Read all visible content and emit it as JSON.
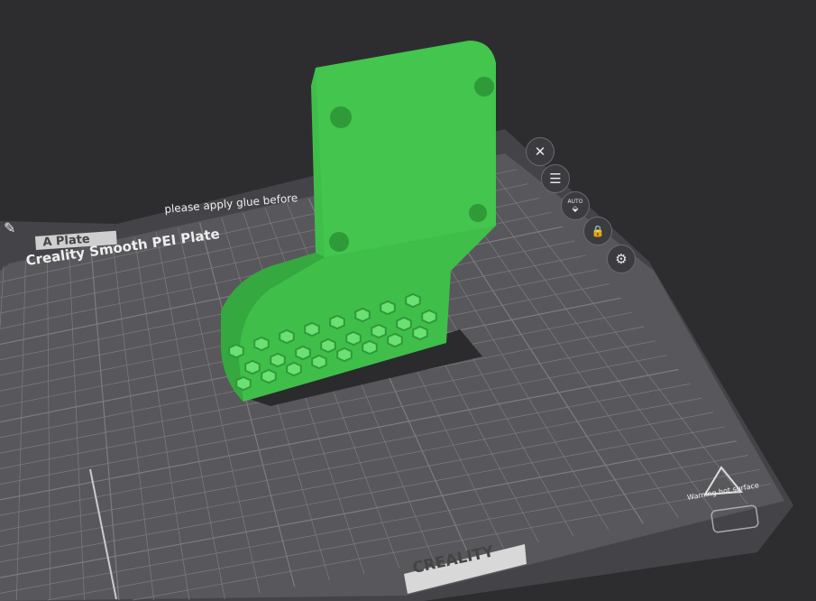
{
  "plate": {
    "name": "Creality Smooth PEI Plate",
    "tab_label": "A Plate",
    "notice": "please apply glue before",
    "brand": "CREALITY",
    "warning": "Warning hot surface"
  },
  "toolbar": [
    {
      "name": "close-icon",
      "glyph": "✕"
    },
    {
      "name": "list-icon",
      "glyph": "☰"
    },
    {
      "name": "auto-orient-icon",
      "glyph": "⬙",
      "label": "AUTO"
    },
    {
      "name": "lock-icon",
      "glyph": "🔒"
    },
    {
      "name": "gear-icon",
      "glyph": "⚙"
    }
  ],
  "colors": {
    "model": "#3fbf4a",
    "plate": "#57575b",
    "grid": "#7d7d80",
    "bg": "#2d2d30"
  }
}
